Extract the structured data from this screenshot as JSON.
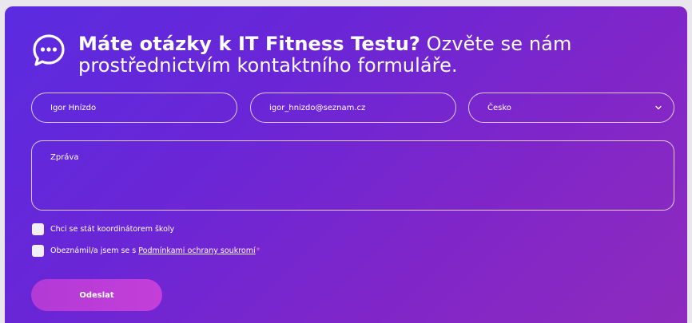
{
  "header": {
    "title_bold": "Máte otázky k IT Fitness Testu?",
    "title_rest": " Ozvěte se nám prostřednictvím kontaktního formuláře.",
    "icon": "chat-bubble-icon"
  },
  "form": {
    "name_value": "Igor Hnízdo",
    "email_value": "igor_hnizdo@seznam.cz",
    "country_value": "Česko",
    "message_placeholder": "Zpráva",
    "checkbox_coordinator_label": "Chci se stát koordinátorem školy",
    "checkbox_privacy_prefix": "Obeznámil/a jsem se s ",
    "checkbox_privacy_link": "Podmínkami ochrany soukromí",
    "required_marker": "*",
    "submit_label": "Odeslat"
  },
  "colors": {
    "gradient_start": "#5b2be0",
    "gradient_end": "#8e2bbd",
    "submit_button": "#b23ad6"
  }
}
